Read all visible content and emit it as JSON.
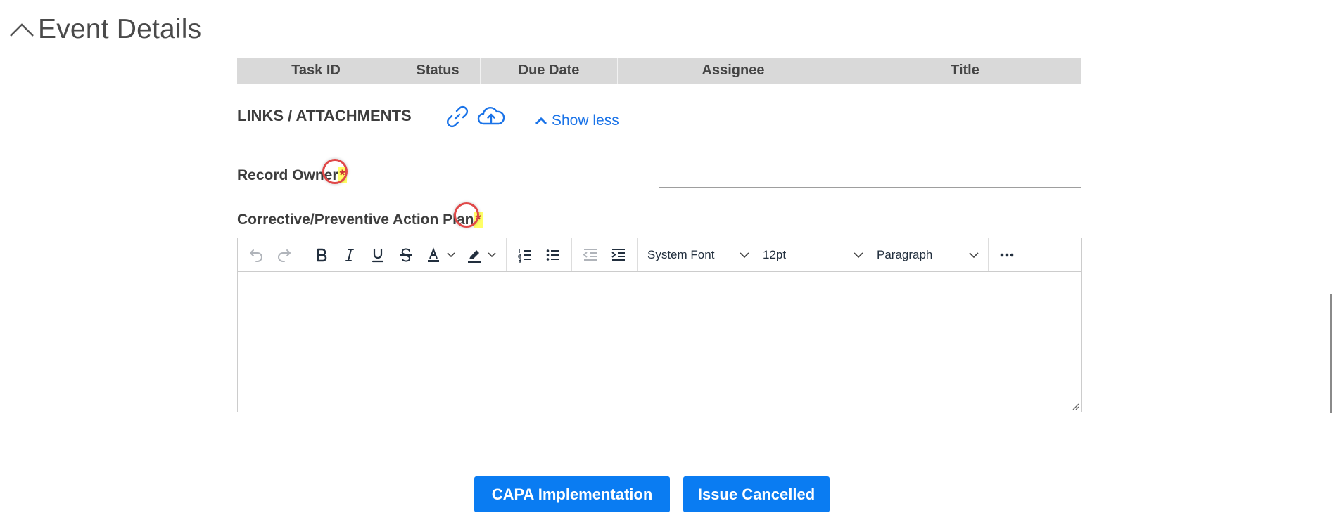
{
  "section": {
    "title": "Event Details",
    "toggle_icon": "chevron-up-icon"
  },
  "task_table": {
    "columns": [
      "Task ID",
      "Status",
      "Due Date",
      "Assignee",
      "Title"
    ]
  },
  "links": {
    "label": "LINKS / ATTACHMENTS",
    "link_icon": "link-icon",
    "upload_icon": "cloud-upload-icon",
    "show_less": "Show less"
  },
  "record_owner": {
    "label": "Record Owner",
    "required_mark": "*",
    "value": ""
  },
  "action_plan": {
    "label": "Corrective/Preventive Action Plan",
    "required_mark": "*"
  },
  "editor": {
    "font_family": "System Font",
    "font_size": "12pt",
    "block_format": "Paragraph",
    "content": ""
  },
  "buttons": {
    "capa": "CAPA Implementation",
    "cancel": "Issue Cancelled"
  },
  "colors": {
    "accent": "#0a7cf2",
    "link": "#1a73e8",
    "required_highlight": "#ffff66",
    "marker": "#e04848",
    "table_header": "#d9d9d9"
  }
}
